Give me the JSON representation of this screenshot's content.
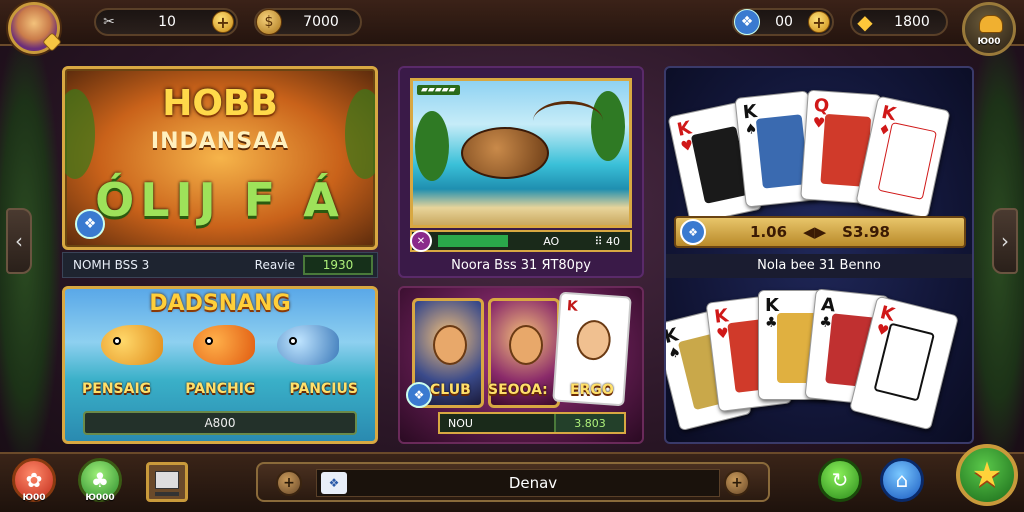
{
  "topbar": {
    "currency1": {
      "icon": "wrench-icon",
      "value": "10"
    },
    "currency2": {
      "icon": "coin-icon",
      "value": "7000"
    },
    "currency3": {
      "icon": "gem-icon",
      "value": "00"
    },
    "currency4": {
      "icon": "gold-icon",
      "value": "1800"
    },
    "settings_label": "Ю00"
  },
  "panel1": {
    "line1": "HOBB",
    "line2": "INDANSAA",
    "line3": "ÓLIJ F Á",
    "bar_left": "NOMH BSS 3",
    "bar_mid": "Reavie",
    "bar_value": "1930"
  },
  "panel2": {
    "title": "DADSNANG",
    "fish_names": [
      "PENSAIG",
      "PANCHIG",
      "PANCIUS"
    ],
    "footer": "A800"
  },
  "panel3": {
    "scene_tag": "▰▰▰▰▰",
    "stat_mid": "AO",
    "stat_right": "⠿ 40",
    "caption": "Noora Bss 31 ЯТ80ру"
  },
  "panel4": {
    "label1": "CLUB",
    "label2": "SEOOA:",
    "label3": "ERGO",
    "footer_left": "NOU",
    "footer_value": "3.803"
  },
  "panel5": {
    "bar_left": "1.06",
    "bar_right": "S3.98",
    "caption": "Nola bee 31 Benno",
    "top_cards": [
      {
        "rank": "K",
        "suit": "♥",
        "color": "red"
      },
      {
        "rank": "K",
        "suit": "♠",
        "color": "blk"
      },
      {
        "rank": "Q",
        "suit": "♥",
        "color": "red"
      },
      {
        "rank": "K",
        "suit": "♦",
        "color": "red"
      }
    ],
    "bottom_cards": [
      {
        "rank": "K",
        "suit": "♠",
        "color": "blk"
      },
      {
        "rank": "K",
        "suit": "♥",
        "color": "red"
      },
      {
        "rank": "K",
        "suit": "♣",
        "color": "blk"
      },
      {
        "rank": "A",
        "suit": "♣",
        "color": "blk"
      },
      {
        "rank": "K",
        "suit": "♥",
        "color": "red"
      }
    ]
  },
  "bottombar": {
    "btn1_label": "Ю00",
    "btn2_label": "Ю000",
    "search_value": "Denav"
  }
}
